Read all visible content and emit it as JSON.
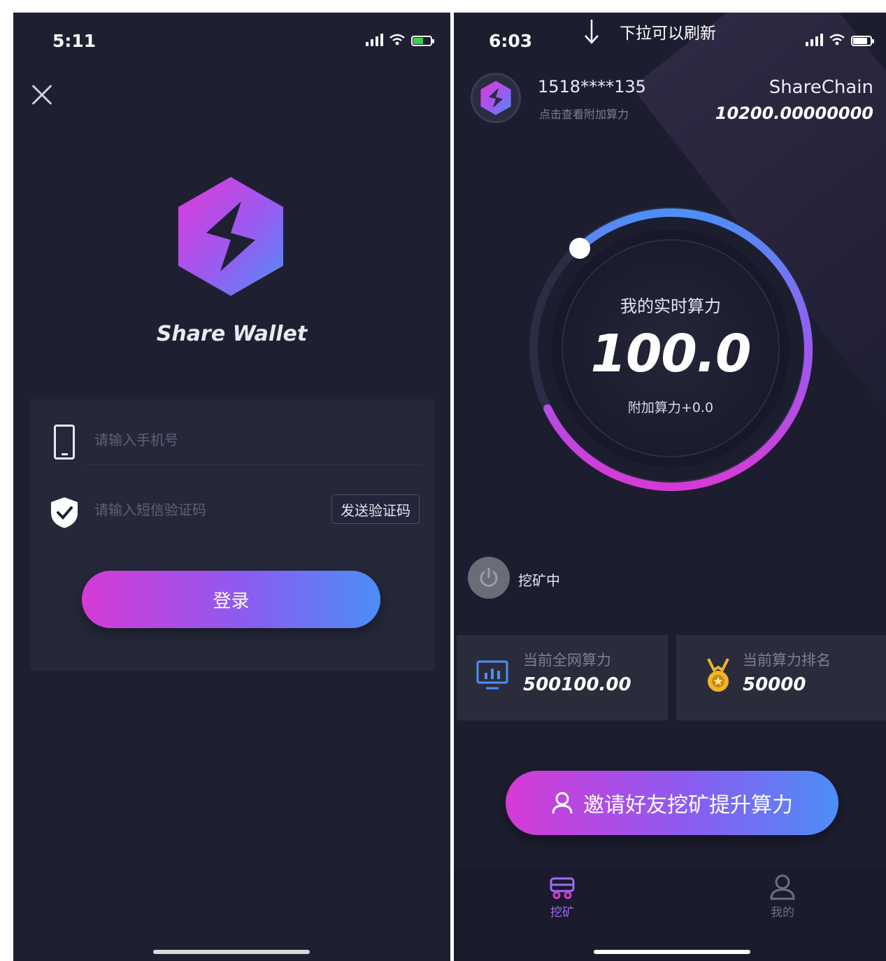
{
  "left_screen": {
    "status_time": "5:11",
    "brand_name": "Share Wallet",
    "phone_placeholder": "请输入手机号",
    "code_placeholder": "请输入短信验证码",
    "send_code_label": "发送验证码",
    "login_label": "登录"
  },
  "right_screen": {
    "status_time": "6:03",
    "pull_hint": "下拉可以刷新",
    "account_number": "1518****135",
    "account_sub": "点击查看附加算力",
    "coin_name": "ShareChain",
    "coin_amount": "10200.00000000",
    "gauge": {
      "title": "我的实时算力",
      "value": "100.0",
      "extra": "附加算力+0.0"
    },
    "mining_status": "挖矿中",
    "stats": {
      "network_label": "当前全网算力",
      "network_value": "500100.00",
      "rank_label": "当前算力排名",
      "rank_value": "50000"
    },
    "invite_label": "邀请好友挖矿提升算力",
    "tabs": [
      {
        "label": "挖矿",
        "active": true
      },
      {
        "label": "我的",
        "active": false
      }
    ]
  },
  "colors": {
    "background": "#1e2032",
    "card": "#252839",
    "gradient_start": "#d63ad6",
    "gradient_end": "#4c8ef6",
    "active_tab": "#9b6cf2",
    "inactive_tab": "#6c6e82"
  },
  "icons": {
    "close": "close-icon",
    "logo": "share-hexagon-logo-icon",
    "phone": "phone-icon",
    "shield": "shield-check-icon",
    "arrow": "arrow-down-icon",
    "power": "power-icon",
    "monitor": "monitor-chart-icon",
    "medal": "medal-icon",
    "user": "user-icon"
  }
}
